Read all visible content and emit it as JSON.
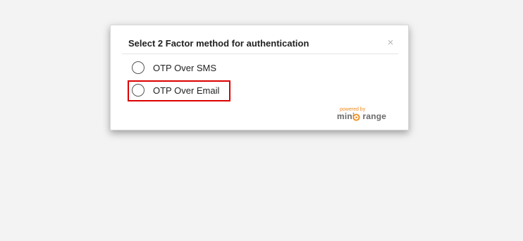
{
  "dialog": {
    "title": "Select 2 Factor method for authentication",
    "close_label": "×"
  },
  "options": [
    {
      "label": "OTP Over SMS",
      "selected": false
    },
    {
      "label": "OTP Over Email",
      "selected": false,
      "highlighted": true
    }
  ],
  "branding": {
    "powered_by": "powered by",
    "name": "miniOrange",
    "name_parts": {
      "prefix": "mini",
      "suffix": "range"
    },
    "accent_color": "#f08a1c"
  },
  "colors": {
    "highlight_border": "#dd0000",
    "page_background": "#f3f3f3"
  }
}
